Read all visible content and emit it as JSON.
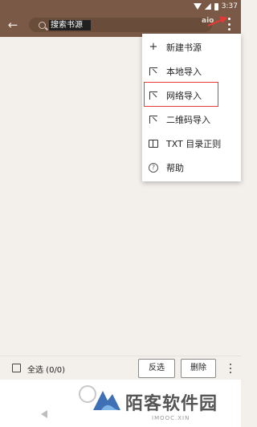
{
  "status_bar": {
    "time": "3:37"
  },
  "toolbar": {
    "search_placeholder": "搜索书源",
    "ai_label": "aio"
  },
  "menu": {
    "items": [
      {
        "label": "新建书源",
        "icon": "plus-icon"
      },
      {
        "label": "本地导入",
        "icon": "import-icon"
      },
      {
        "label": "网络导入",
        "icon": "import-icon",
        "highlighted": true
      },
      {
        "label": "二维码导入",
        "icon": "import-icon"
      },
      {
        "label": "TXT 目录正则",
        "icon": "book-icon"
      },
      {
        "label": "帮助",
        "icon": "help-icon"
      }
    ],
    "highlight_color": "#e53935"
  },
  "bottom_bar": {
    "select_all_label": "全选 (0/0)",
    "invert_label": "反选",
    "delete_label": "删除"
  },
  "watermark": {
    "title": "陌客软件园",
    "subtitle": "IMOOC.XIN"
  },
  "colors": {
    "primary": "#7a5a47",
    "background": "#f3f0ec",
    "accent_red": "#e53935"
  }
}
